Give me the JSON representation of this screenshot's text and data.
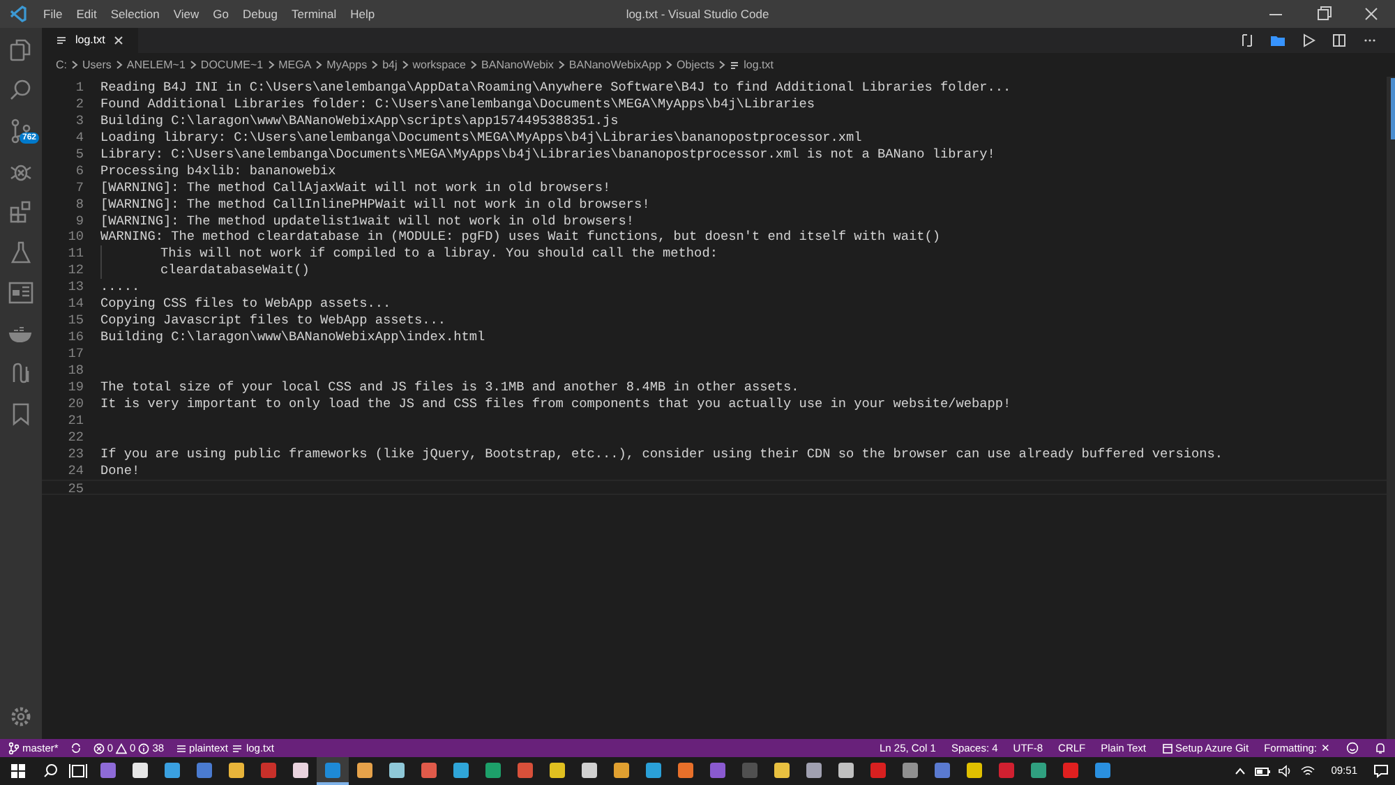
{
  "window": {
    "title": "log.txt - Visual Studio Code"
  },
  "menu": [
    "File",
    "Edit",
    "Selection",
    "View",
    "Go",
    "Debug",
    "Terminal",
    "Help"
  ],
  "activity_bar": {
    "source_control_badge": "762"
  },
  "tabs": [
    {
      "label": "log.txt",
      "selected": true
    }
  ],
  "breadcrumbs": [
    "C:",
    "Users",
    "ANELEM~1",
    "DOCUME~1",
    "MEGA",
    "MyApps",
    "b4j",
    "workspace",
    "BANanoWebix",
    "BANanoWebixApp",
    "Objects",
    "log.txt"
  ],
  "editor": {
    "lines": [
      {
        "number": "1",
        "text": "Reading B4J INI in C:\\Users\\anelembanga\\AppData\\Roaming\\Anywhere Software\\B4J to find Additional Libraries folder..."
      },
      {
        "number": "2",
        "text": "Found Additional Libraries folder: C:\\Users\\anelembanga\\Documents\\MEGA\\MyApps\\b4j\\Libraries"
      },
      {
        "number": "3",
        "text": "Building C:\\laragon\\www\\BANanoWebixApp\\scripts\\app1574495388351.js"
      },
      {
        "number": "4",
        "text": "Loading library: C:\\Users\\anelembanga\\Documents\\MEGA\\MyApps\\b4j\\Libraries\\bananopostprocessor.xml"
      },
      {
        "number": "5",
        "text": "Library: C:\\Users\\anelembanga\\Documents\\MEGA\\MyApps\\b4j\\Libraries\\bananopostprocessor.xml is not a BANano library!"
      },
      {
        "number": "6",
        "text": "Processing b4xlib: bananowebix"
      },
      {
        "number": "7",
        "text": "[WARNING]: The method CallAjaxWait will not work in old browsers!"
      },
      {
        "number": "8",
        "text": "[WARNING]: The method CallInlinePHPWait will not work in old browsers!"
      },
      {
        "number": "9",
        "text": "[WARNING]: The method updatelist1wait will not work in old browsers!"
      },
      {
        "number": "10",
        "text": "WARNING: The method cleardatabase in (MODULE: pgFD) uses Wait functions, but doesn't end itself with wait()",
        "children": [
          {
            "number": "11",
            "text": "This will not work if compiled to a libray. You should call the method:"
          },
          {
            "number": "12",
            "text": "cleardatabaseWait()"
          }
        ]
      },
      {
        "number": "13",
        "text": "....."
      },
      {
        "number": "14",
        "text": "Copying CSS files to WebApp assets..."
      },
      {
        "number": "15",
        "text": "Copying Javascript files to WebApp assets..."
      },
      {
        "number": "16",
        "text": "Building C:\\laragon\\www\\BANanoWebixApp\\index.html"
      },
      {
        "number": "17"
      },
      {
        "number": "18"
      },
      {
        "number": "19",
        "text": "The total size of your local CSS and JS files is 3.1MB and another 8.4MB in other assets."
      },
      {
        "number": "20",
        "text": "It is very important to only load the JS and CSS files from components that you actually use in your website/webapp!"
      },
      {
        "number": "21"
      },
      {
        "number": "22"
      },
      {
        "number": "23",
        "text": "If you are using public frameworks (like jQuery, Bootstrap, etc...), consider using their CDN so the browser can use already buffered versions."
      },
      {
        "number": "24",
        "text": "Done!"
      },
      {
        "number": "25",
        "current": true
      }
    ]
  },
  "status_bar": {
    "branch": "master*",
    "errors": "0",
    "warnings": "0",
    "infos": "38",
    "language_tag": "plaintext",
    "file": "log.txt",
    "position": "Ln 25, Col 1",
    "spaces": "Spaces: 4",
    "encoding": "UTF-8",
    "eol": "CRLF",
    "language": "Plain Text",
    "azure": "Setup Azure Git",
    "formatting": "Formatting:",
    "formatting_symbol": "✕"
  },
  "taskbar": {
    "apps": [
      {
        "color": "#8e6bd8",
        "selected": false
      },
      {
        "color": "#e6e6e6",
        "selected": false
      },
      {
        "color": "#3aa0e0",
        "selected": false
      },
      {
        "color": "#4a7bd0",
        "selected": false
      },
      {
        "color": "#e8b43a",
        "selected": false
      },
      {
        "color": "#c8302a",
        "selected": false
      },
      {
        "color": "#e9d3de",
        "selected": false
      },
      {
        "color": "#1e8ad6",
        "selected": true
      },
      {
        "color": "#e6a24a",
        "selected": false
      },
      {
        "color": "#8fc8d8",
        "selected": false
      },
      {
        "color": "#e05a4a",
        "selected": false
      },
      {
        "color": "#2fa5d8",
        "selected": false
      },
      {
        "color": "#1da06a",
        "selected": false
      },
      {
        "color": "#d8503a",
        "selected": false
      },
      {
        "color": "#e0c020",
        "selected": false
      },
      {
        "color": "#d0d0d0",
        "selected": false
      },
      {
        "color": "#e0a030",
        "selected": false
      },
      {
        "color": "#2aa0d8",
        "selected": false
      },
      {
        "color": "#e8702a",
        "selected": false
      },
      {
        "color": "#8a5ad0",
        "selected": false
      },
      {
        "color": "#505050",
        "selected": false
      },
      {
        "color": "#e8c040",
        "selected": false
      },
      {
        "color": "#a0a0b0",
        "selected": false
      },
      {
        "color": "#c0c0c0",
        "selected": false
      },
      {
        "color": "#d82020",
        "selected": false
      },
      {
        "color": "#909090",
        "selected": false
      },
      {
        "color": "#5a7ad0",
        "selected": false
      },
      {
        "color": "#e0c000",
        "selected": false
      },
      {
        "color": "#d02030",
        "selected": false
      },
      {
        "color": "#30a080",
        "selected": false
      },
      {
        "color": "#e02020",
        "selected": false
      },
      {
        "color": "#2a90e0",
        "selected": false
      }
    ],
    "time": "09:51"
  }
}
